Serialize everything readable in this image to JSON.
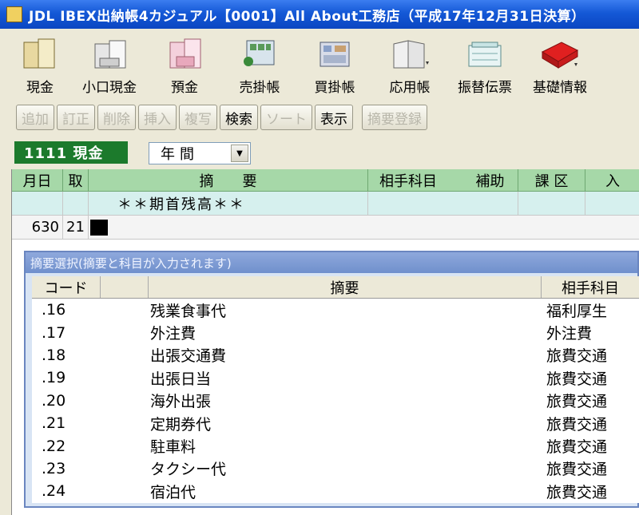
{
  "window": {
    "title": "JDL IBEX出納帳4カジュアル【0001】All About工務店（平成17年12月31日決算）"
  },
  "toolbar": {
    "items": [
      {
        "label": "現金",
        "icon": "cash-icon"
      },
      {
        "label": "小口現金",
        "icon": "petty-cash-icon"
      },
      {
        "label": "預金",
        "icon": "deposit-icon"
      },
      {
        "label": "売掛帳",
        "icon": "receivables-icon"
      },
      {
        "label": "買掛帳",
        "icon": "payables-icon"
      },
      {
        "label": "応用帳",
        "icon": "applied-book-icon"
      },
      {
        "label": "振替伝票",
        "icon": "transfer-slip-icon"
      },
      {
        "label": "基礎情報",
        "icon": "basic-info-icon"
      }
    ]
  },
  "actions": {
    "add": "追加",
    "fix": "訂正",
    "delete": "削除",
    "insert": "挿入",
    "copy": "複写",
    "search": "検索",
    "sort": "ソート",
    "display": "表示",
    "register": "摘要登録"
  },
  "account": {
    "label": "1111 現金",
    "period": "年間"
  },
  "ledger": {
    "columns": [
      "月日",
      "取",
      "摘　　要",
      "相手科目",
      "補助",
      "課 区",
      "入"
    ],
    "opening_row": "＊＊期首残高＊＊",
    "entry_row": {
      "date": "630",
      "code": "21"
    }
  },
  "popup": {
    "title": "摘要選択(摘要と科目が入力されます)",
    "columns": [
      "コード",
      "",
      "摘要",
      "相手科目"
    ],
    "rows": [
      {
        "code": ".16",
        "summary": "残業食事代",
        "account": "福利厚生"
      },
      {
        "code": ".17",
        "summary": "外注費",
        "account": "外注費"
      },
      {
        "code": ".18",
        "summary": "出張交通費",
        "account": "旅費交通"
      },
      {
        "code": ".19",
        "summary": "出張日当",
        "account": "旅費交通"
      },
      {
        "code": ".20",
        "summary": "海外出張",
        "account": "旅費交通"
      },
      {
        "code": ".21",
        "summary": "定期券代",
        "account": "旅費交通"
      },
      {
        "code": ".22",
        "summary": "駐車料",
        "account": "旅費交通"
      },
      {
        "code": ".23",
        "summary": "タクシー代",
        "account": "旅費交通"
      },
      {
        "code": ".24",
        "summary": "宿泊代",
        "account": "旅費交通"
      }
    ]
  }
}
